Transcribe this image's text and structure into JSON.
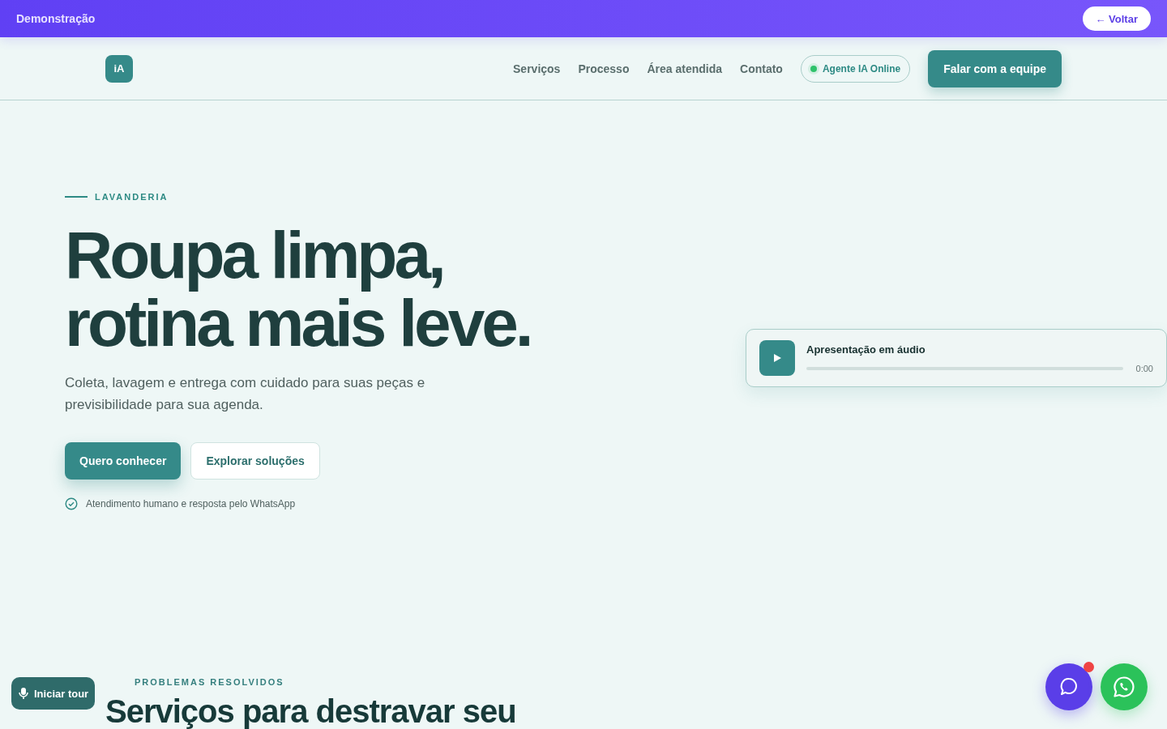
{
  "demo_bar": {
    "title": "Demonstração",
    "back_button": "← Voltar"
  },
  "nav": {
    "logo": "iA",
    "links": [
      "Serviços",
      "Processo",
      "Área atendida",
      "Contato"
    ],
    "agent_badge": {
      "label": "Agente IA Online",
      "online": true
    },
    "cta": "Falar com a equipe"
  },
  "hero": {
    "eyebrow": "LAVANDERIA",
    "title_lines": [
      "Roupa limpa,",
      "rotina mais leve."
    ],
    "subtitle": "Coleta, lavagem e entrega com cuidado para suas peças e previsibilidade para sua agenda.",
    "buttons": [
      {
        "label": "Quero conhecer",
        "kind": "primary"
      },
      {
        "label": "Explorar soluções",
        "kind": "ghost"
      }
    ],
    "note": "Atendimento humano e resposta pelo WhatsApp"
  },
  "audio": {
    "title": "Apresentação em áudio",
    "time": "0:00"
  },
  "tour_button": "Iniciar tour",
  "problems": {
    "eyebrow": "PROBLEMAS RESOLVIDOS",
    "title": "Serviços para destravar seu"
  },
  "chat_button": {
    "unread": true
  }
}
